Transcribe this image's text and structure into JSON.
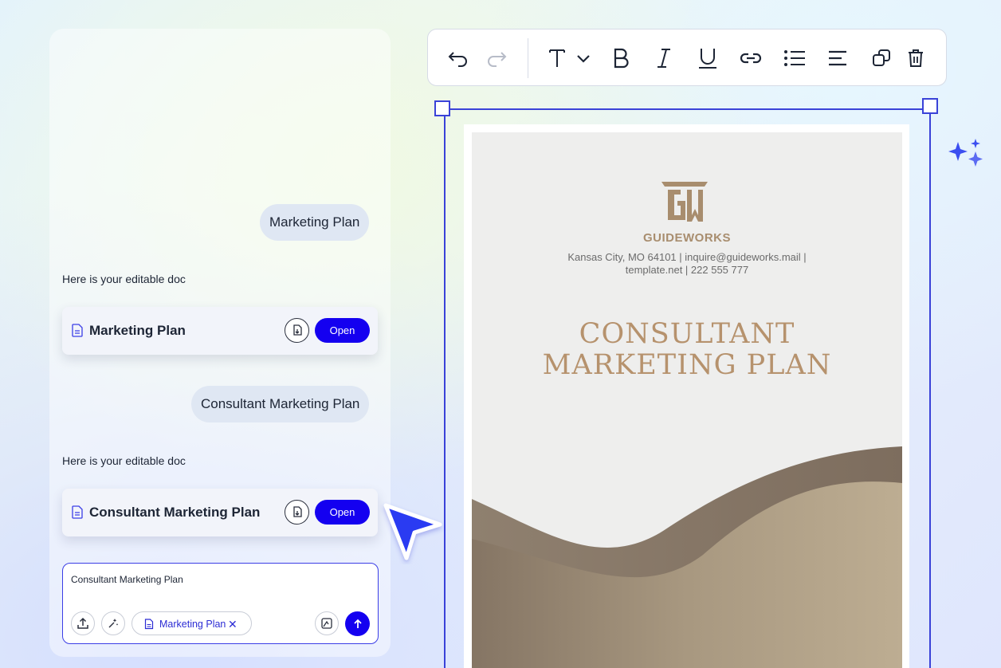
{
  "chat": {
    "messages": [
      {
        "role": "user",
        "text": "Marketing Plan"
      },
      {
        "role": "assistant",
        "text": "Here is your editable doc",
        "doc_title": "Marketing Plan",
        "open_label": "Open"
      },
      {
        "role": "user",
        "text": "Consultant Marketing Plan"
      },
      {
        "role": "assistant",
        "text": "Here is your editable doc",
        "doc_title": "Consultant Marketing Plan",
        "open_label": "Open"
      }
    ],
    "composer": {
      "value": "Consultant Marketing Plan",
      "attachment_chip": "Marketing Plan",
      "chip_remove": "✕"
    }
  },
  "toolbar": {
    "buttons": [
      "undo-icon",
      "redo-icon",
      "text-style-icon",
      "bold-icon",
      "italic-icon",
      "underline-icon",
      "link-icon",
      "bullet-list-icon",
      "align-icon",
      "duplicate-icon",
      "delete-icon"
    ]
  },
  "document": {
    "brand": "GUIDEWORKS",
    "address_line1": "Kansas City, MO 64101 | inquire@guideworks.mail |",
    "address_line2": "template.net | 222 555 777",
    "title_line1": "CONSULTANT",
    "title_line2": "MARKETING PLAN"
  },
  "colors": {
    "accent": "#1400f0",
    "selection": "#3a42d8",
    "gold": "#b6926d",
    "wave_dark": "#8a7b6c",
    "wave_light": "#bfae93"
  }
}
